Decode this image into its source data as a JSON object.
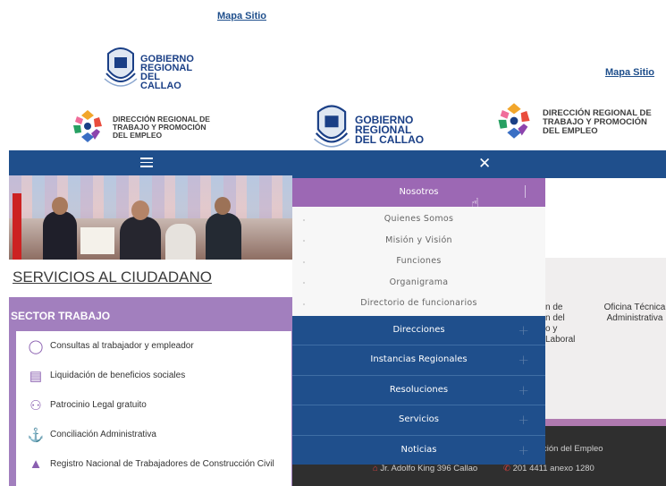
{
  "left": {
    "sitemap_link": "Mapa Sitio",
    "gobierno": {
      "line1": "GOBIERNO",
      "line2": "REGIONAL",
      "line3": "DEL CALLAO"
    },
    "direccion": {
      "line1": "DIRECCIÓN REGIONAL DE",
      "line2": "TRABAJO Y PROMOCIÓN",
      "line3": "DEL EMPLEO"
    },
    "services_title": "SERVICIOS AL CIUDADANO",
    "sector_title": "SECTOR TRABAJO",
    "services": [
      {
        "label": "Consultas al trabajador y empleador",
        "icon": "person-icon"
      },
      {
        "label": "Liquidación de beneficios sociales",
        "icon": "document-icon"
      },
      {
        "label": "Patrocinio Legal gratuito",
        "icon": "people-icon"
      },
      {
        "label": "Conciliación Administrativa",
        "icon": "meeting-icon"
      },
      {
        "label": "Registro Nacional de Trabajadores de Construcción Civil",
        "icon": "worker-icon"
      }
    ]
  },
  "right": {
    "sitemap_link": "Mapa Sitio",
    "gobierno": {
      "line1": "GOBIERNO",
      "line2": "REGIONAL",
      "line3": "DEL CALLAO"
    },
    "direccion": {
      "line1": "DIRECCIÓN REGIONAL DE",
      "line2": "TRABAJO Y PROMOCIÓN",
      "line3": "DEL EMPLEO"
    },
    "close_glyph": "✕",
    "menu": {
      "active": "Nosotros",
      "submenu": [
        "Quienes Somos",
        "Misión y Visión",
        "Funciones",
        "Organigrama",
        "Directorio de funcionarios"
      ],
      "items": [
        "Direcciones",
        "Instancias Regionales",
        "Resoluciones",
        "Servicios",
        "Noticias"
      ]
    },
    "background": {
      "col1": [
        "n de",
        "n del",
        "o y",
        "Laboral"
      ],
      "col2": [
        "Oficina Técnica",
        "Administrativa"
      ],
      "footer_line1": "ción del Empleo",
      "footer_address": "Jr. Adolfo King 396 Callao",
      "footer_phone": "201 4411 anexo 1280"
    }
  }
}
